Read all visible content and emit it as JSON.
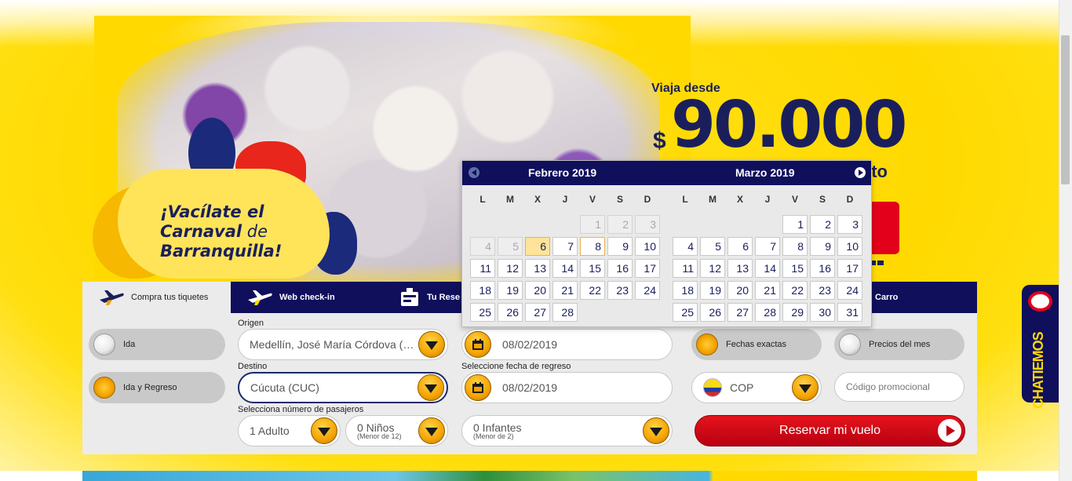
{
  "hero": {
    "carnaval_line1": "¡Vacílate el",
    "carnaval_line2": "Carnaval",
    "carnaval_line2_suffix": " de",
    "carnaval_line3": "Barranquilla!",
    "promo_prefix": "Viaja desde",
    "promo_currency": "$",
    "promo_price": "90.000",
    "promo_asterisk": "*",
    "promo_tail": "cto"
  },
  "tabs": [
    {
      "label": "Compra tus tiquetes",
      "icon": "plane-icon"
    },
    {
      "label": "Web check-in",
      "icon": "checkin-plane-icon"
    },
    {
      "label": "Tu Rese",
      "icon": "reservation-icon"
    },
    {
      "label": "Carro",
      "icon": "car-icon"
    }
  ],
  "trip_type": {
    "one_way": "Ida",
    "round_trip": "Ida y Regreso",
    "selected": "Ida y Regreso"
  },
  "origin": {
    "label": "Origen",
    "value": "Medellín, José María Córdova (M..."
  },
  "destination": {
    "label": "Destino",
    "value": "Cúcuta (CUC)"
  },
  "passengers": {
    "label": "Selecciona número de pasajeros",
    "adults": "1 Adulto",
    "children": "0 Niños",
    "children_note": "(Menor de 12)",
    "infants": "0 Infantes",
    "infants_note": "(Menor de 2)"
  },
  "dates": {
    "departure": "08/02/2019",
    "return_label": "Seleccione fecha de regreso",
    "return": "08/02/2019"
  },
  "date_mode": {
    "exact": "Fechas exactas",
    "monthly": "Precios del mes",
    "selected": "Fechas exactas"
  },
  "currency": "COP",
  "promo_code": {
    "placeholder": "Código promocional",
    "value": ""
  },
  "reserve_button": "Reservar mi vuelo",
  "calendar": {
    "weekdays": [
      "L",
      "M",
      "X",
      "J",
      "V",
      "S",
      "D"
    ],
    "months": [
      {
        "title": "Febrero 2019",
        "weeks": [
          [
            null,
            null,
            null,
            null,
            "1",
            "2",
            "3"
          ],
          [
            "4",
            "5",
            "6",
            "7",
            "8",
            "9",
            "10"
          ],
          [
            "11",
            "12",
            "13",
            "14",
            "15",
            "16",
            "17"
          ],
          [
            "18",
            "19",
            "20",
            "21",
            "22",
            "23",
            "24"
          ],
          [
            "25",
            "26",
            "27",
            "28",
            null,
            null,
            null
          ]
        ],
        "disabled": [
          "1",
          "2",
          "3",
          "4",
          "5"
        ],
        "today": "6",
        "selected": "8"
      },
      {
        "title": "Marzo 2019",
        "weeks": [
          [
            null,
            null,
            null,
            null,
            "1",
            "2",
            "3"
          ],
          [
            "4",
            "5",
            "6",
            "7",
            "8",
            "9",
            "10"
          ],
          [
            "11",
            "12",
            "13",
            "14",
            "15",
            "16",
            "17"
          ],
          [
            "18",
            "19",
            "20",
            "21",
            "22",
            "23",
            "24"
          ],
          [
            "25",
            "26",
            "27",
            "28",
            "29",
            "30",
            "31"
          ]
        ],
        "disabled": [],
        "today": null,
        "selected": null
      }
    ]
  },
  "chat": {
    "label": "CHATIEMOS"
  },
  "colors": {
    "navy": "#0f0f5c",
    "yellow": "#ffd900",
    "red": "#e2001a",
    "orange": "#f5a300"
  }
}
